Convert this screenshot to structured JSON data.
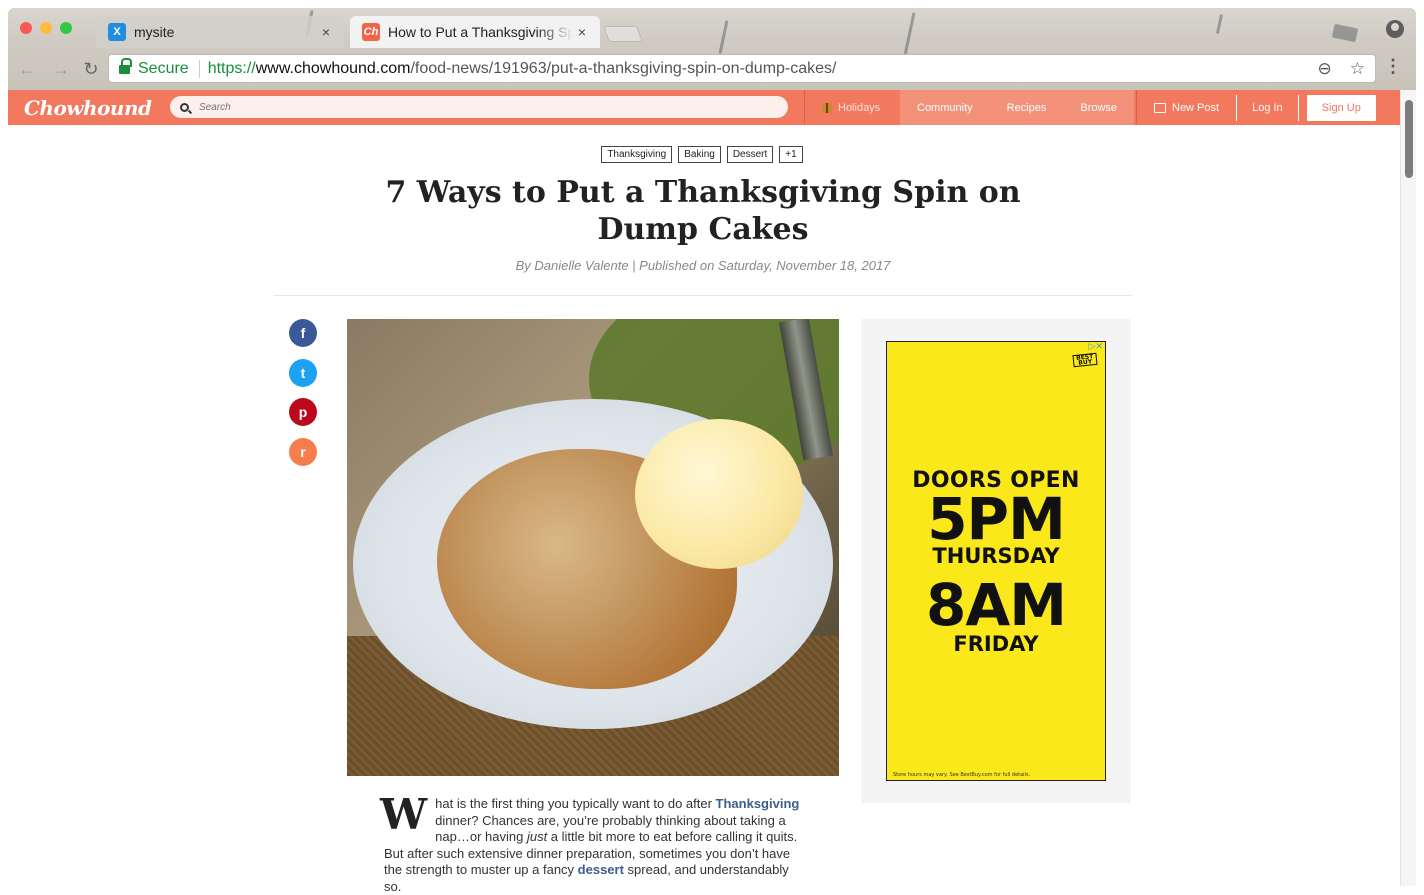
{
  "browser": {
    "tabs": [
      {
        "title": "mysite",
        "favicon": "X",
        "close": "×"
      },
      {
        "title": "How to Put a Thanksgiving Spin on Dump Cakes",
        "favicon": "Ch",
        "close": "×"
      }
    ],
    "omnibox": {
      "secure_label": "Secure",
      "url_scheme": "https://",
      "url_host": "www.chowhound.com",
      "url_path": "/food-news/191963/put-a-thanksgiving-spin-on-dump-cakes/"
    },
    "icons": {
      "back": "←",
      "forward": "→",
      "reload": "↻",
      "zoom": "⊖",
      "star": "☆",
      "menu": "⋮"
    }
  },
  "site": {
    "logo": "Chowhound",
    "search_placeholder": "Search",
    "nav": {
      "holidays": "Holidays",
      "community": "Community",
      "recipes": "Recipes",
      "browse": "Browse",
      "new_post": "New Post",
      "log_in": "Log In",
      "sign_up": "Sign Up"
    },
    "colors": {
      "brand": "#f2785e",
      "link": "#3b5f8a"
    }
  },
  "article": {
    "tags": [
      "Thanksgiving",
      "Baking",
      "Dessert",
      "+1"
    ],
    "title": "7 Ways to Put a Thanksgiving Spin on Dump Cakes",
    "byline": "By Danielle Valente | Published on Saturday, November 18, 2017",
    "share": {
      "facebook": "f",
      "twitter": "t",
      "pinterest": "p",
      "reddit": "r"
    },
    "dropcap": "W",
    "body": {
      "p1": "hat is the first thing you typically want to do after ",
      "link1": "Thanksgiving",
      "p2": " dinner? Chances are, you’re probably thinking about taking a nap…or having ",
      "em": "just",
      "p3": " a little bit more to eat before calling it quits. But after such extensive dinner preparation, sometimes you don’t have the strength to muster up a fancy ",
      "link2": "dessert",
      "p4": " spread, and understandably so."
    }
  },
  "ad": {
    "choices": "▷✕",
    "logo": "BEST BUY",
    "line1": "DOORS OPEN",
    "line2": "5PM",
    "line3": "THURSDAY",
    "line4": "8AM",
    "line5": "FRIDAY",
    "fine_print": "Store hours may vary. See BestBuy.com for full details.",
    "color": "#fbe81a"
  }
}
